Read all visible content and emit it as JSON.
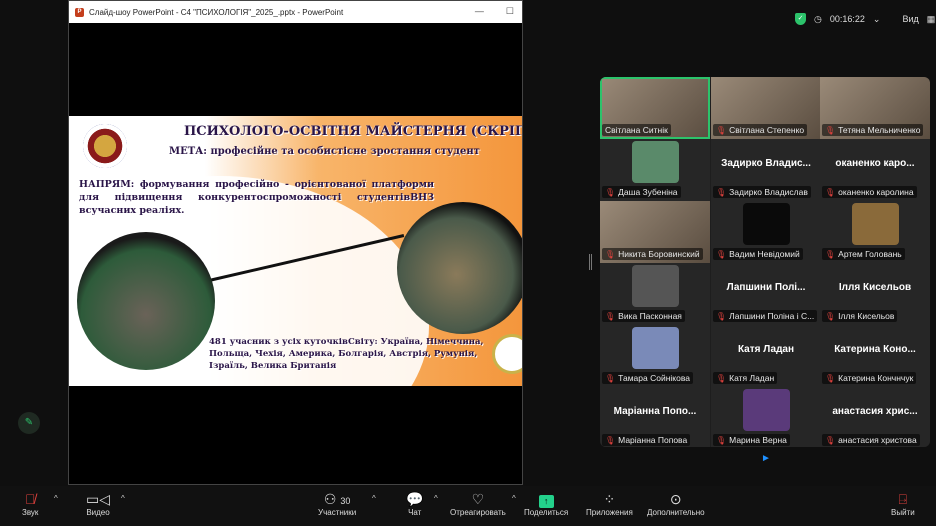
{
  "ppt": {
    "title": "Слайд-шоу PowerPoint  -  С4 \"ПСИХОЛОГІЯ\"_2025_.pptx - PowerPoint",
    "minimize": "—",
    "maximize": "☐"
  },
  "slide": {
    "title": "ПСИХОЛОГО-ОСВІТНЯ МАЙСТЕРНЯ (СКРІПКА",
    "goal": "МЕТА: професійне та особистісне зростання студент",
    "direction": "НАПРЯМ: формування професійно - орієнтованої платформи для підвищення конкурентоспроможності студентівВНЗ всучасних реаліях.",
    "participants": "481 учасник з усіх куточківСвіту: Україна, Німеччина, Польща, Чехія, Америка, Болгарія, Австрія, Румунія, Ізраїль, Велика Британія"
  },
  "meeting": {
    "timer": "00:16:22",
    "view_label": "Вид"
  },
  "participants": [
    {
      "name": "Світлана Ситнік",
      "type": "video",
      "active": true,
      "muted": false
    },
    {
      "name": "Світлана Степенко",
      "type": "video",
      "muted": true
    },
    {
      "name": "Тетяна Мельниченко",
      "type": "video",
      "muted": true
    },
    {
      "name": "Даша Зубеніна",
      "type": "avatar",
      "muted": true,
      "color": "#5a8a6a"
    },
    {
      "name": "Задирко Владислав",
      "display": "Задирко Владис...",
      "type": "name",
      "muted": true
    },
    {
      "name": "оканенко каролина",
      "display": "оканенко каро...",
      "type": "name",
      "muted": true
    },
    {
      "name": "Никита Боровинский",
      "type": "video",
      "muted": true
    },
    {
      "name": "Вадим Невідомий",
      "type": "avatar",
      "muted": true,
      "color": "#0a0a0a"
    },
    {
      "name": "Артем Головань",
      "type": "avatar",
      "muted": true,
      "color": "#8a6a3a"
    },
    {
      "name": "Вика Пасконная",
      "type": "avatar",
      "muted": true,
      "color": "#555"
    },
    {
      "name": "Лапшини Поліна і С...",
      "display": "Лапшини Полі...",
      "type": "name",
      "muted": true
    },
    {
      "name": "Ілля Кисельов",
      "display": "Ілля Кисельов",
      "type": "name",
      "muted": true
    },
    {
      "name": "Тамара Сойнікова",
      "type": "avatar",
      "muted": true,
      "color": "#7a8ab8"
    },
    {
      "name": "Катя Ладан",
      "display": "Катя Ладан",
      "type": "name",
      "muted": true
    },
    {
      "name": "Катерина Кончнчук",
      "display": "Катерина Коно...",
      "type": "name",
      "muted": true
    },
    {
      "name": "Маріанна Попова",
      "display": "Маріанна Попо...",
      "type": "name",
      "muted": true
    },
    {
      "name": "Марина Верна",
      "type": "avatar",
      "muted": true,
      "color": "#5a3a7a"
    },
    {
      "name": "анастасия христова",
      "display": "анастасия хрис...",
      "type": "name",
      "muted": true
    }
  ],
  "toolbar": {
    "audio": "Звук",
    "video": "Видео",
    "participants": "Участники",
    "participants_count": "30",
    "chat": "Чат",
    "react": "Отреагировать",
    "share": "Поделиться",
    "apps": "Приложения",
    "more": "Дополнительно",
    "leave": "Выйти"
  }
}
